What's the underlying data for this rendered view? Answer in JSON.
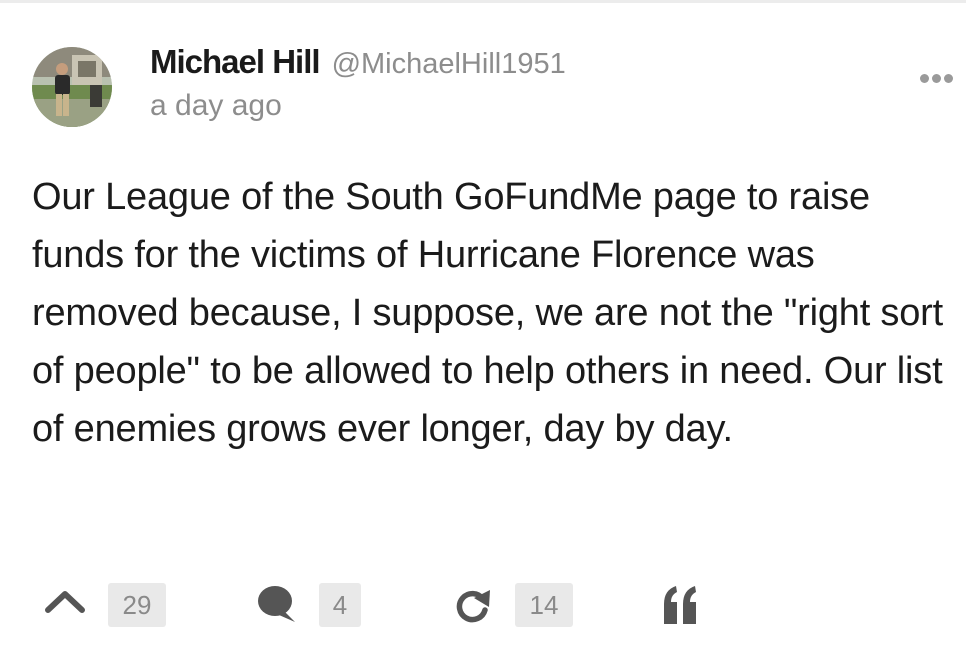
{
  "post": {
    "author_name": "Michael Hill",
    "author_handle": "@MichaelHill1951",
    "timestamp": "a day ago",
    "body": "Our League of the South GoFundMe page to raise funds for the victims of Hurricane Florence was removed because, I suppose, we are not the \"right sort of people\" to be allowed to help others in need. Our list of enemies grows ever longer, day by day.",
    "menu_icon": "more-dots-icon"
  },
  "actions": {
    "upvote": {
      "icon": "upvote-chevron-icon",
      "count": "29"
    },
    "comment": {
      "icon": "comment-bubble-icon",
      "count": "4"
    },
    "repost": {
      "icon": "repost-arrow-icon",
      "count": "14"
    },
    "quote": {
      "icon": "quote-icon"
    }
  },
  "colors": {
    "icon": "#555555",
    "count_bg": "#e9e9e9",
    "muted_text": "#8d8d8d"
  }
}
